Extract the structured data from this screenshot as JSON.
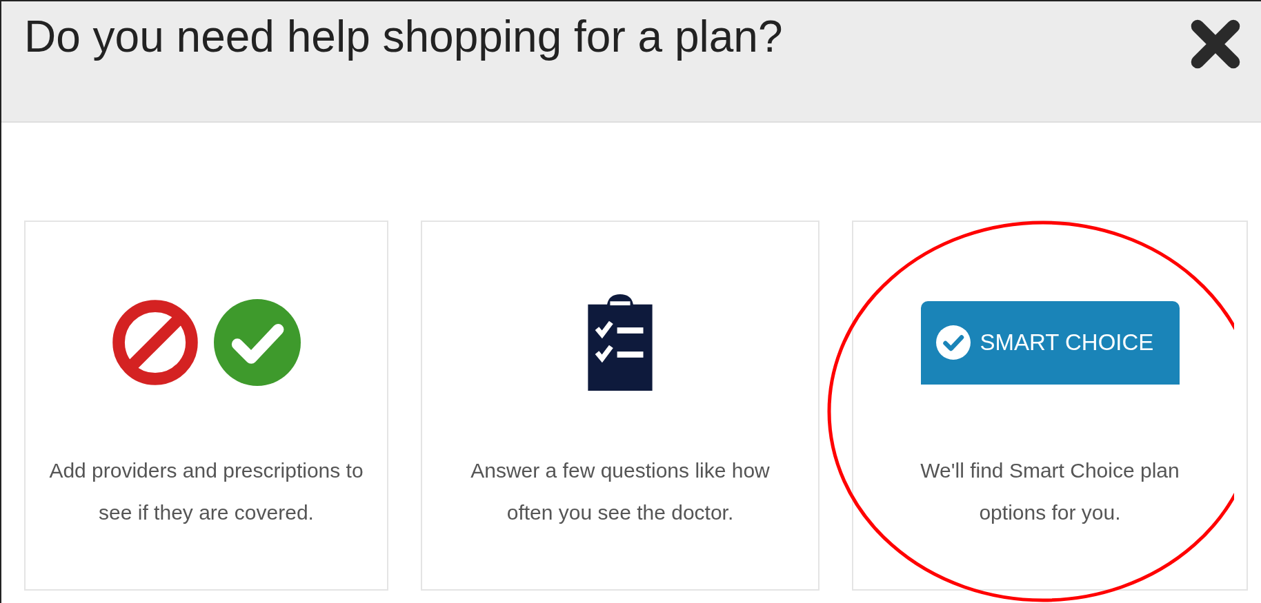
{
  "dialog": {
    "title": "Do you need help shopping for a plan?"
  },
  "cards": [
    {
      "kind": "provider-check",
      "text": "Add providers and prescriptions to see if they are covered.",
      "circled": false
    },
    {
      "kind": "questionnaire",
      "text": "Answer a few questions like how often you see the doctor.",
      "circled": false
    },
    {
      "kind": "badge",
      "badge_label": "SMART CHOICE",
      "text": "We'll find Smart Choice plan options for you.",
      "circled": true
    }
  ]
}
